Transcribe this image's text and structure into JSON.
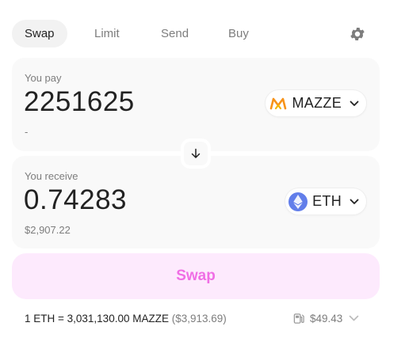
{
  "tabs": [
    {
      "label": "Swap",
      "active": true
    },
    {
      "label": "Limit",
      "active": false
    },
    {
      "label": "Send",
      "active": false
    },
    {
      "label": "Buy",
      "active": false
    }
  ],
  "settings_icon": "gear-icon",
  "pay": {
    "label": "You pay",
    "amount": "2251625",
    "usd_value": "-",
    "token": {
      "symbol": "MAZZE",
      "logo_icon": "mazze-logo-icon",
      "logo_color": "#f7931a"
    }
  },
  "flip_icon": "arrow-down-icon",
  "receive": {
    "label": "You receive",
    "amount": "0.74283",
    "usd_value": "$2,907.22",
    "token": {
      "symbol": "ETH",
      "logo_icon": "eth-logo-icon",
      "logo_color": "#627eea"
    }
  },
  "swap_button": {
    "label": "Swap",
    "text_color": "#f06ee5",
    "bg_color": "#fdeafd"
  },
  "rate": {
    "text": "1 ETH = 3,031,130.00 MAZZE",
    "usd": "($3,913.69)"
  },
  "gas": {
    "icon": "gas-pump-icon",
    "value": "$49.43"
  }
}
